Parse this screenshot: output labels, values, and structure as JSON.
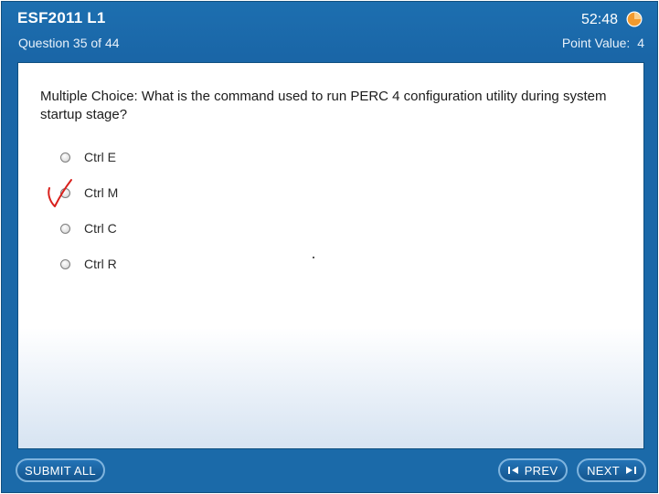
{
  "header": {
    "exam_title": "ESF2011  L1",
    "question_counter": "Question 35 of 44",
    "timer": "52:48",
    "point_value_label": "Point Value:",
    "point_value": "4"
  },
  "question": {
    "text": "Multiple Choice:  What is the command used to run PERC 4 configuration utility during system startup stage?",
    "options": [
      {
        "label": "Ctrl E",
        "selected": false
      },
      {
        "label": "Ctrl M",
        "selected": false
      },
      {
        "label": "Ctrl C",
        "selected": false
      },
      {
        "label": "Ctrl R",
        "selected": false
      }
    ]
  },
  "footer": {
    "submit_label": "SUBMIT ALL",
    "prev_label": "PREV",
    "next_label": "NEXT"
  },
  "icons": {
    "timer": "timer-clock-icon",
    "prev": "prev-arrow-icon",
    "next": "next-arrow-icon",
    "annotation": "handwritten-checkmark"
  },
  "colors": {
    "header_blue": "#1a66a7",
    "timer_orange": "#f39a2d",
    "annotation_red": "#d9201c",
    "button_border": "#7fb4de"
  }
}
